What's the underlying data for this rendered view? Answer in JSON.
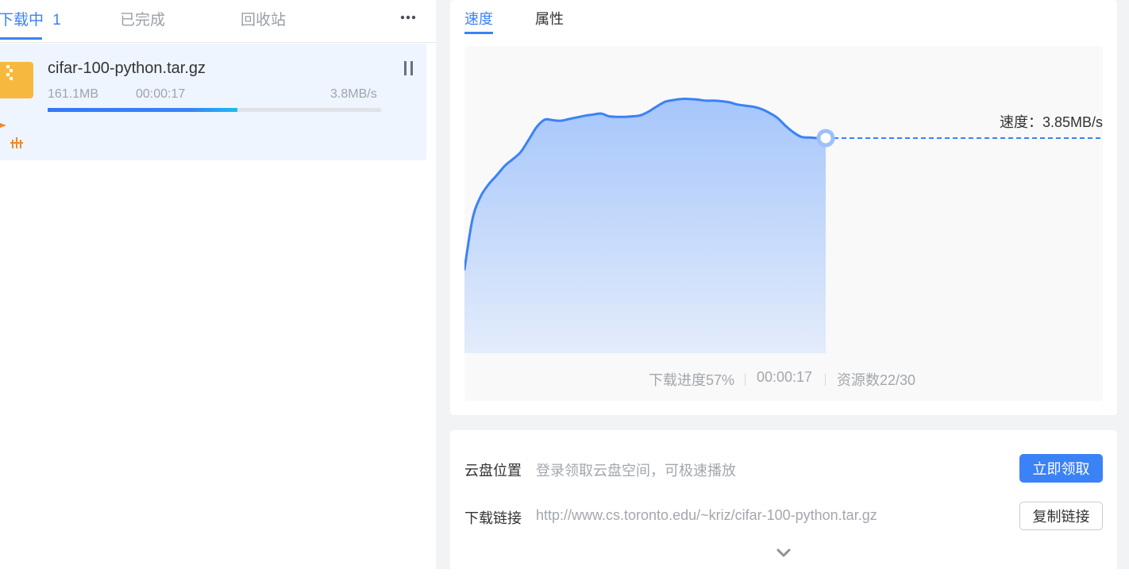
{
  "left_tabs": {
    "downloading_label": "下载中",
    "downloading_count": "1",
    "completed_label": "已完成",
    "recycle_label": "回收站",
    "more_icon": "more-dots-icon"
  },
  "download": {
    "file_name": "cifar-100-python.tar.gz",
    "file_size": "161.1MB",
    "elapsed": "00:00:17",
    "speed": "3.8MB/s",
    "progress_fraction": 0.57,
    "file_icon": "archive-file-icon",
    "pause_icon": "pause-icon"
  },
  "right_tabs": {
    "speed_label": "速度",
    "properties_label": "属性"
  },
  "chart_data": {
    "type": "area",
    "title": "",
    "xlabel": "",
    "ylabel": "",
    "current_label": "速度：3.85MB/s",
    "x": [
      0,
      1,
      2,
      3,
      4,
      5,
      6,
      7,
      8,
      9,
      10,
      11,
      12,
      13,
      14,
      15,
      16,
      17,
      18,
      19,
      20,
      21,
      22,
      23,
      24,
      25,
      26,
      27,
      28,
      29,
      30,
      31,
      32,
      33,
      34,
      35,
      36,
      37,
      38,
      39,
      40,
      41,
      42,
      43,
      44,
      45
    ],
    "values": [
      1.5,
      2.4,
      2.8,
      3.02,
      3.18,
      3.35,
      3.47,
      3.6,
      3.82,
      4.05,
      4.18,
      4.17,
      4.16,
      4.19,
      4.22,
      4.25,
      4.27,
      4.29,
      4.24,
      4.23,
      4.23,
      4.24,
      4.26,
      4.33,
      4.42,
      4.5,
      4.53,
      4.55,
      4.55,
      4.54,
      4.52,
      4.52,
      4.51,
      4.49,
      4.45,
      4.43,
      4.41,
      4.37,
      4.3,
      4.21,
      4.07,
      3.95,
      3.87,
      3.86,
      3.85,
      3.85
    ],
    "ylim": [
      0,
      5
    ],
    "grid": false,
    "color": "#3b82f6",
    "fill_top": "#a6c6fb",
    "fill_bottom": "#e3ecfb"
  },
  "stats": {
    "progress": "下载进度57%",
    "time": "00:00:17",
    "sources": "资源数22/30"
  },
  "info": {
    "cloud_label": "云盘位置",
    "cloud_value": "登录领取云盘空间，可极速播放",
    "claim_button": "立即领取",
    "link_label": "下载链接",
    "link_value": "http://www.cs.toronto.edu/~kriz/cifar-100-python.tar.gz",
    "copy_button": "复制链接",
    "expand_icon": "chevron-down-icon"
  },
  "colors": {
    "accent": "#3b82f6",
    "file_icon": "#f7b83f",
    "accel_icon": "#f08a24"
  }
}
